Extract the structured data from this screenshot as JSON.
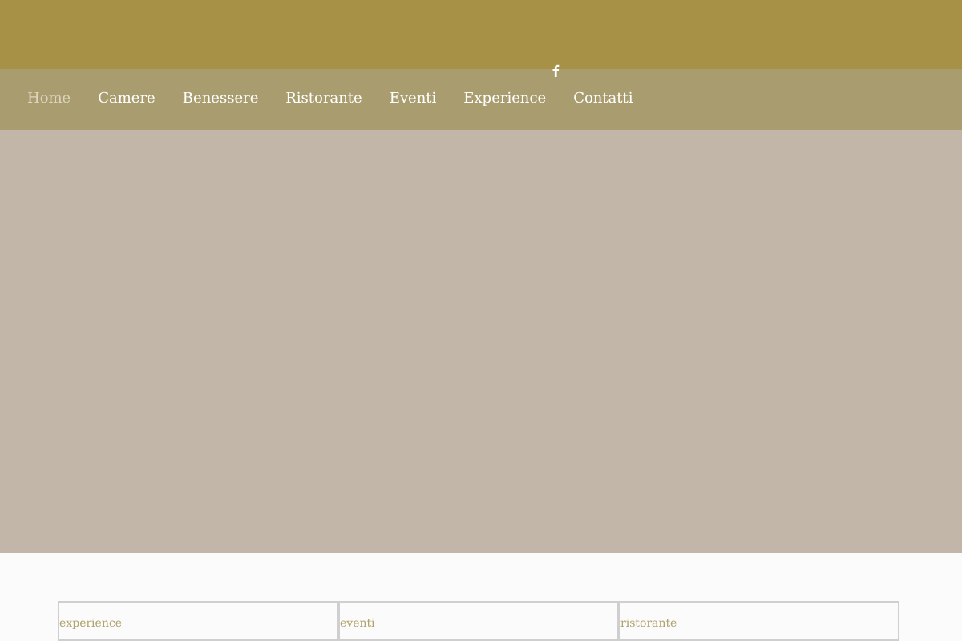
{
  "nav": [
    {
      "label": "Home",
      "selected": true
    },
    {
      "label": "Camere",
      "selected": false
    },
    {
      "label": "Benessere",
      "selected": false
    },
    {
      "label": "Ristorante",
      "selected": false
    },
    {
      "label": "Eventi",
      "selected": false
    },
    {
      "label": "Experience",
      "selected": false
    },
    {
      "label": "Contatti",
      "selected": false
    }
  ],
  "cards": [
    {
      "label": "experience"
    },
    {
      "label": "eventi"
    },
    {
      "label": "ristorante"
    }
  ]
}
